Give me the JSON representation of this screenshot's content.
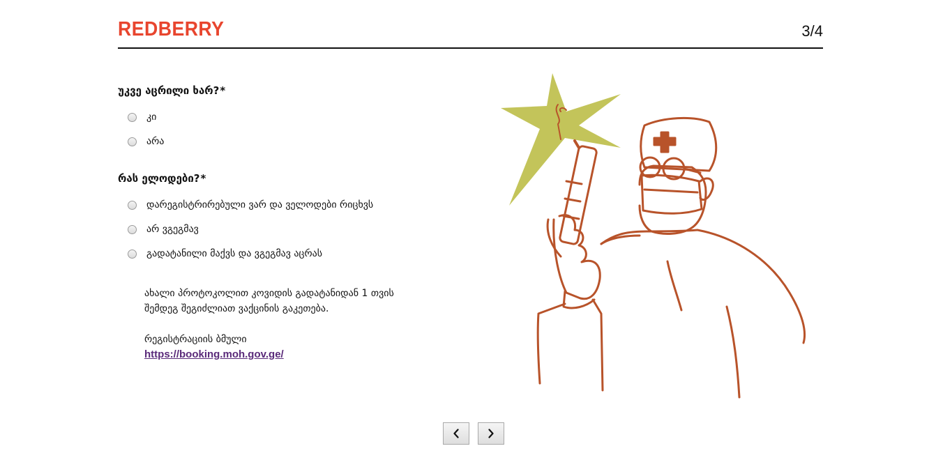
{
  "header": {
    "logo": "REDBERRY",
    "step": "3/4"
  },
  "questions": [
    {
      "label": "უკვე აცრილი ხარ?",
      "required_mark": "*",
      "options": [
        "კი",
        "არა"
      ]
    },
    {
      "label": "რას ელოდები?",
      "required_mark": "*",
      "options": [
        "დარეგისტრირებული ვარ და ველოდები რიცხვს",
        "არ ვგეგმავ",
        "გადატანილი მაქვს და ვგეგმავ აცრას"
      ]
    }
  ],
  "info": {
    "line1": "ახალი პროტოკოლით კოვიდის გადატანიდან 1 თვის",
    "line2": "შემდეგ შეგიძლიათ ვაქცინის გაკეთება.",
    "link_label": "რეგისტრაციის ბმული",
    "link_text": "https://booking.moh.gov.ge/"
  },
  "navigation": {
    "prev_icon": "chevron-left-icon",
    "next_icon": "chevron-right-icon"
  },
  "colors": {
    "brand": "#e8452e",
    "illustration_line": "#b8532a",
    "star": "#c3c45a",
    "link": "#5a2a7a"
  }
}
